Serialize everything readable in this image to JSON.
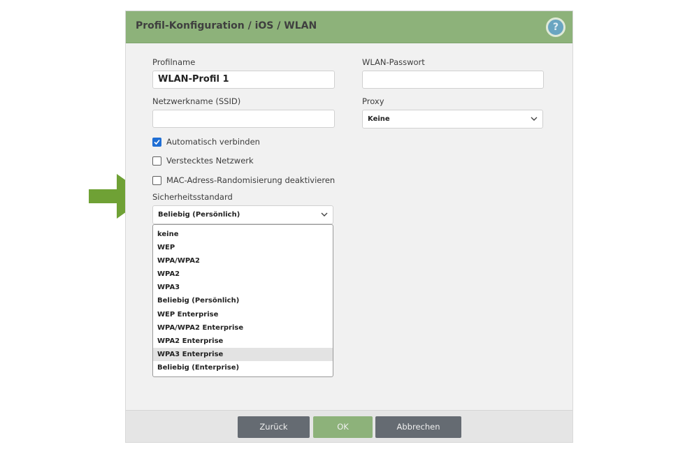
{
  "dialog": {
    "title": "Profil-Konfiguration / iOS / WLAN",
    "help_glyph": "?"
  },
  "form": {
    "profile_name": {
      "label": "Profilname",
      "value": "WLAN-Profil 1"
    },
    "wifi_password": {
      "label": "WLAN-Passwort",
      "value": ""
    },
    "ssid": {
      "label": "Netzwerkname (SSID)",
      "value": ""
    },
    "proxy": {
      "label": "Proxy",
      "selected": "Keine"
    },
    "checkboxes": [
      {
        "label": "Automatisch verbinden",
        "checked": true
      },
      {
        "label": "Verstecktes Netzwerk",
        "checked": false
      },
      {
        "label": "MAC-Adress-Randomisierung deaktivieren",
        "checked": false
      }
    ],
    "security": {
      "label": "Sicherheitsstandard",
      "selected": "Beliebig (Persönlich)",
      "options": [
        "keine",
        "WEP",
        "WPA/WPA2",
        "WPA2",
        "WPA3",
        "Beliebig (Persönlich)",
        "WEP Enterprise",
        "WPA/WPA2 Enterprise",
        "WPA2 Enterprise",
        "WPA3 Enterprise",
        "Beliebig (Enterprise)"
      ],
      "highlighted_option": "WPA3 Enterprise"
    }
  },
  "footer": {
    "back_label": "Zurück",
    "ok_label": "OK",
    "cancel_label": "Abbrechen"
  },
  "colors": {
    "titlebar": "#8db27a",
    "arrow": "#6fa135",
    "button_dark": "#656b72",
    "button_ok": "#8db27a",
    "checkbox_checked": "#1f6ed4",
    "help_icon": "#6aa5c1"
  },
  "icons": {
    "annotation_arrow": "arrow-right-icon",
    "help": "help-icon",
    "select_chevron": "chevron-down-icon",
    "checkmark": "checkmark-icon"
  }
}
